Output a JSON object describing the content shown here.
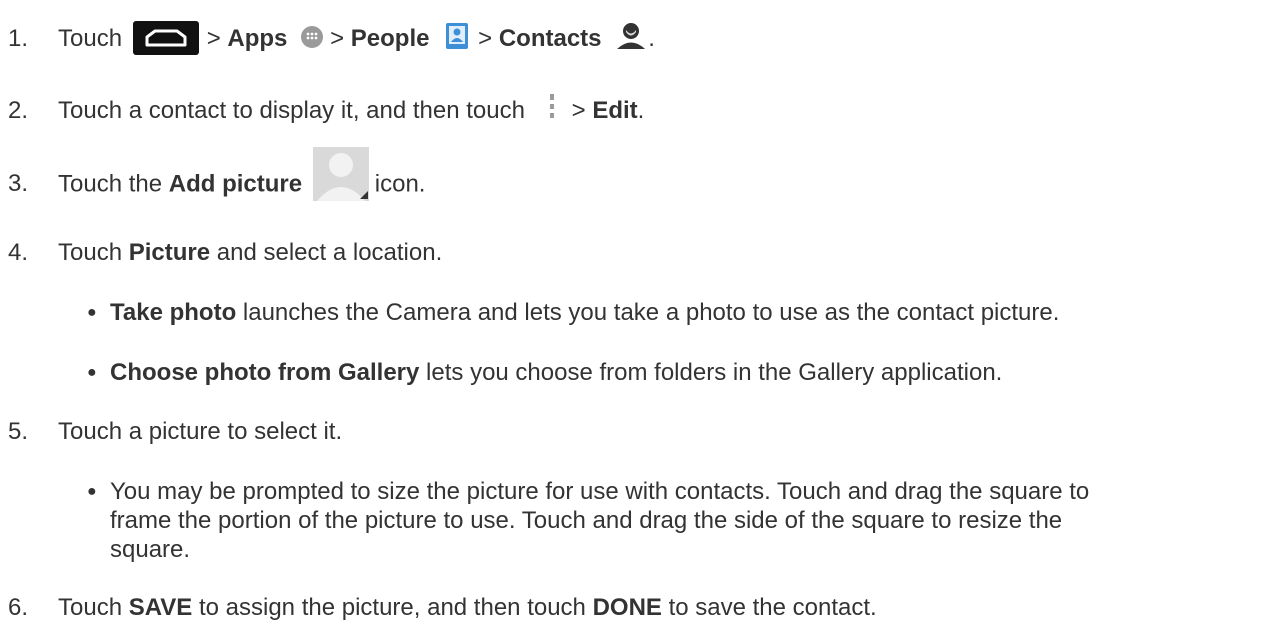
{
  "steps": [
    {
      "number": "1.",
      "parts": {
        "touch": "Touch",
        "gt1": ">",
        "apps": "Apps",
        "gt2": ">",
        "people": "People",
        "gt3": ">",
        "contacts": "Contacts",
        "period": "."
      }
    },
    {
      "number": "2.",
      "parts": {
        "pre": "Touch a contact to display it, and then touch",
        "gt": ">",
        "edit": "Edit",
        "period": "."
      }
    },
    {
      "number": "3.",
      "parts": {
        "pre": "Touch the",
        "add_picture": "Add picture",
        "post": "icon."
      }
    },
    {
      "number": "4.",
      "parts": {
        "pre": "Touch",
        "picture": "Picture",
        "post": "and select a location."
      },
      "bullets": [
        {
          "bold": "Take photo",
          "text": "launches the Camera and lets you take a photo to use as the contact picture."
        },
        {
          "bold": "Choose photo from Gallery",
          "text": "lets you choose from folders in the Gallery application."
        }
      ]
    },
    {
      "number": "5.",
      "parts": {
        "text": "Touch a picture to select it."
      },
      "bullets": [
        {
          "line1": "You may be prompted to size the picture for use with contacts. Touch and drag the square to",
          "line2": "frame the portion of the picture to use. Touch and drag the side of the square to resize the",
          "line3": "square."
        }
      ]
    },
    {
      "number": "6.",
      "parts": {
        "pre": "Touch",
        "save": "SAVE",
        "mid": "to assign the picture, and then touch",
        "done": "DONE",
        "post": "to save the contact."
      }
    }
  ],
  "icons": {
    "home": "home-icon",
    "apps": "apps-icon",
    "people": "people-icon",
    "contacts": "contacts-icon",
    "menu": "menu-icon",
    "add_picture": "picture-placeholder-icon"
  }
}
